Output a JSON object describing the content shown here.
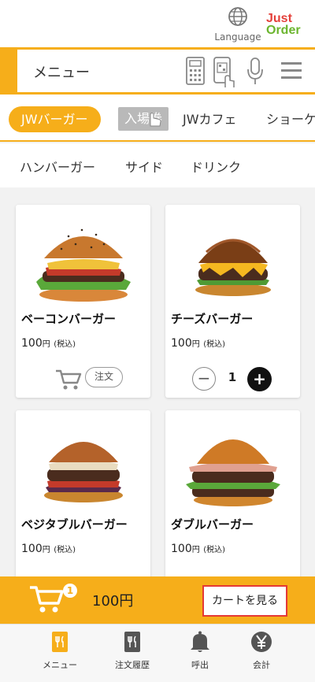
{
  "header": {
    "language_label": "Language",
    "logo_line1": "Just",
    "logo_line2": "Order"
  },
  "menubar": {
    "title": "メニュー",
    "icons": [
      "calculator-icon",
      "qr-scan-icon",
      "microphone-icon",
      "hamburger-menu-icon"
    ]
  },
  "categories": [
    {
      "label": "JWバーガー",
      "active": true
    },
    {
      "label": "入場券",
      "active": false
    },
    {
      "label": "JWカフェ",
      "active": false
    },
    {
      "label": "ショーケース",
      "active": false
    }
  ],
  "subcategories": [
    {
      "label": "ハンバーガー"
    },
    {
      "label": "サイド"
    },
    {
      "label": "ドリンク"
    }
  ],
  "products": [
    {
      "name": "ベーコンバーガー",
      "price": "100",
      "currency": "円",
      "tax": "(税込)",
      "order_label": "注文"
    },
    {
      "name": "チーズバーガー",
      "price": "100",
      "currency": "円",
      "tax": "(税込)",
      "quantity": "1"
    },
    {
      "name": "ベジタブルバーガー",
      "price": "100",
      "currency": "円",
      "tax": "(税込)"
    },
    {
      "name": "ダブルバーガー",
      "price": "100",
      "currency": "円",
      "tax": "(税込)"
    }
  ],
  "cartbar": {
    "badge_count": "1",
    "total": "100円",
    "view_cart_label": "カートを見る"
  },
  "bottom_nav": [
    {
      "label": "メニュー",
      "icon": "menu-book-icon"
    },
    {
      "label": "注文履歴",
      "icon": "order-history-icon"
    },
    {
      "label": "呼出",
      "icon": "bell-icon"
    },
    {
      "label": "会計",
      "icon": "yen-icon"
    }
  ],
  "colors": {
    "accent": "#f6ae1a",
    "highlight_border": "#e53935"
  }
}
